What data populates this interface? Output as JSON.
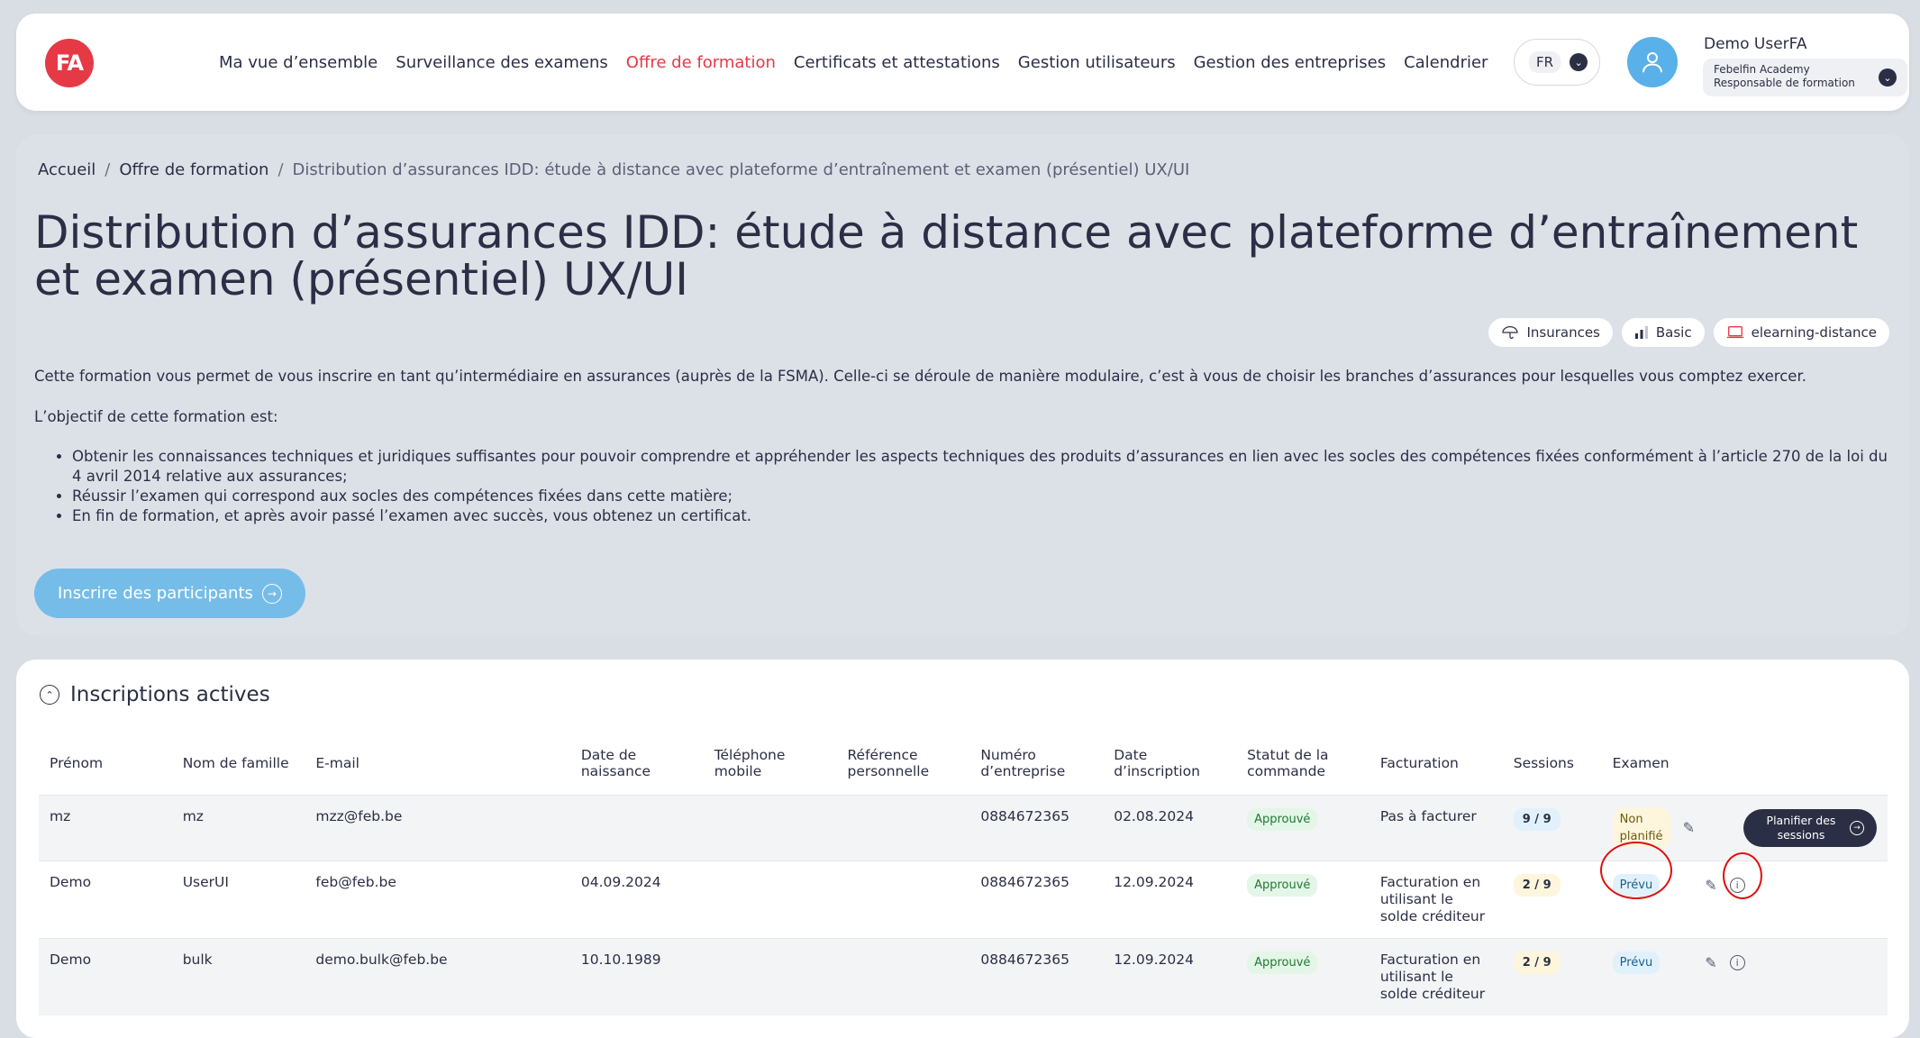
{
  "header": {
    "logo_text": "FA",
    "nav": [
      {
        "label": "Ma vue d’ensemble",
        "active": false
      },
      {
        "label": "Surveillance des examens",
        "active": false
      },
      {
        "label": "Offre de formation",
        "active": true
      },
      {
        "label": "Certificats et attestations",
        "active": false
      },
      {
        "label": "Gestion utilisateurs",
        "active": false
      },
      {
        "label": "Gestion des entreprises",
        "active": false
      },
      {
        "label": "Calendrier",
        "active": false
      }
    ],
    "lang": "FR",
    "user": {
      "name": "Demo UserFA",
      "org": "Febelfin Academy",
      "role": "Responsable de formation"
    }
  },
  "breadcrumb": {
    "home": "Accueil",
    "parent": "Offre de formation",
    "current": "Distribution d’assurances IDD: étude à distance avec plateforme d’entraînement et examen (présentiel) UX/UI"
  },
  "course": {
    "title": "Distribution d’assurances IDD: étude à distance avec plateforme d’entraînement et examen (présentiel) UX/UI",
    "tags": [
      "Insurances",
      "Basic",
      "elearning-distance"
    ],
    "intro": "Cette formation vous permet de vous inscrire en tant qu’intermédiaire en assurances (auprès de la FSMA). Celle-ci se déroule de manière modulaire, c’est à vous de choisir les branches d’assurances pour lesquelles vous comptez exercer.",
    "objective_label": "L’objectif de cette formation est:",
    "objectives": [
      "Obtenir les connaissances techniques et juridiques suffisantes pour pouvoir comprendre et appréhender les aspects techniques des produits d’assurances en lien avec les socles des compétences fixées conformément à l’article 270 de la loi du 4 avril 2014 relative aux assurances;",
      "Réussir l’examen qui correspond aux socles des compétences fixées dans cette matière;",
      "En fin de formation, et après avoir passé l’examen avec succès, vous obtenez un certificat."
    ],
    "cta": "Inscrire des participants"
  },
  "registrations": {
    "title": "Inscriptions actives",
    "columns": {
      "first_name": "Prénom",
      "last_name": "Nom de famille",
      "email": "E-mail",
      "birth": "Date de naissance",
      "phone": "Téléphone mobile",
      "ref": "Référence personnelle",
      "company": "Numéro d’entreprise",
      "reg_date": "Date d’inscription",
      "status": "Statut de la commande",
      "billing": "Facturation",
      "sessions": "Sessions",
      "exam": "Examen"
    },
    "rows": [
      {
        "first_name": "mz",
        "last_name": "mz",
        "email": "mzz@feb.be",
        "birth": "",
        "phone": "",
        "ref": "",
        "company": "0884672365",
        "reg_date": "02.08.2024",
        "status": "Approuvé",
        "billing": "Pas à facturer",
        "sessions": "9 / 9",
        "exam": "Non planifié",
        "action": "Planifier des sessions"
      },
      {
        "first_name": "Demo",
        "last_name": "UserUI",
        "email": "feb@feb.be",
        "birth": "04.09.2024",
        "phone": "",
        "ref": "",
        "company": "0884672365",
        "reg_date": "12.09.2024",
        "status": "Approuvé",
        "billing": "Facturation en utilisant le solde créditeur",
        "sessions": "2 / 9",
        "exam": "Prévu"
      },
      {
        "first_name": "Demo",
        "last_name": "bulk",
        "email": "demo.bulk@feb.be",
        "birth": "10.10.1989",
        "phone": "",
        "ref": "",
        "company": "0884672365",
        "reg_date": "12.09.2024",
        "status": "Approuvé",
        "billing": "Facturation en utilisant le solde créditeur",
        "sessions": "2 / 9",
        "exam": "Prévu"
      }
    ]
  },
  "colors": {
    "accent_red": "#e63946",
    "cta_blue": "#75bde8",
    "dark": "#2b2f45"
  }
}
